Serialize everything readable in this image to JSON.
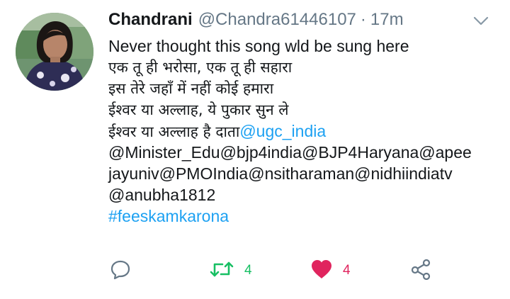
{
  "tweet": {
    "display_name": "Chandrani",
    "handle": "@Chandra61446107",
    "separator": "·",
    "time": "17m",
    "text": {
      "l1": "Never thought this song wld be sung here",
      "l2": "एक तू ही भरोसा, एक तू ही सहारा",
      "l3": "इस तेरे जहाँ में नहीं कोई हमारा",
      "l4": "ईश्वर या अल्लाह, ये पुकार सुन ले",
      "l5": "ईश्वर या अल्लाह है दाता",
      "mention_ugc": "@ugc_india",
      "mention_minister": "@Minister_Edu",
      "mention_bjp4india": "@bjp4india",
      "mention_bjp4haryana": "@BJP4Haryana",
      "mention_apee_a": "@apee",
      "mention_apee_b": "jayuniv",
      "mention_pmo": "@PMOIndia",
      "mention_nsitharaman": "@nsitharaman",
      "mention_nidhi": "@nidhiindiatv",
      "mention_anubha": "@anubha1812",
      "hashtag": "#feeskamkarona"
    }
  },
  "actions": {
    "reply_icon": "comment-bubble-icon",
    "retweet_icon": "retweet-arrows-icon",
    "retweet_count": "4",
    "like_icon": "heart-filled-icon",
    "like_count": "4",
    "share_icon": "share-nodes-icon"
  },
  "colors": {
    "text": "#14171a",
    "muted": "#657786",
    "link": "#1da1f2",
    "retweet": "#17bf63",
    "like": "#e0245e"
  }
}
